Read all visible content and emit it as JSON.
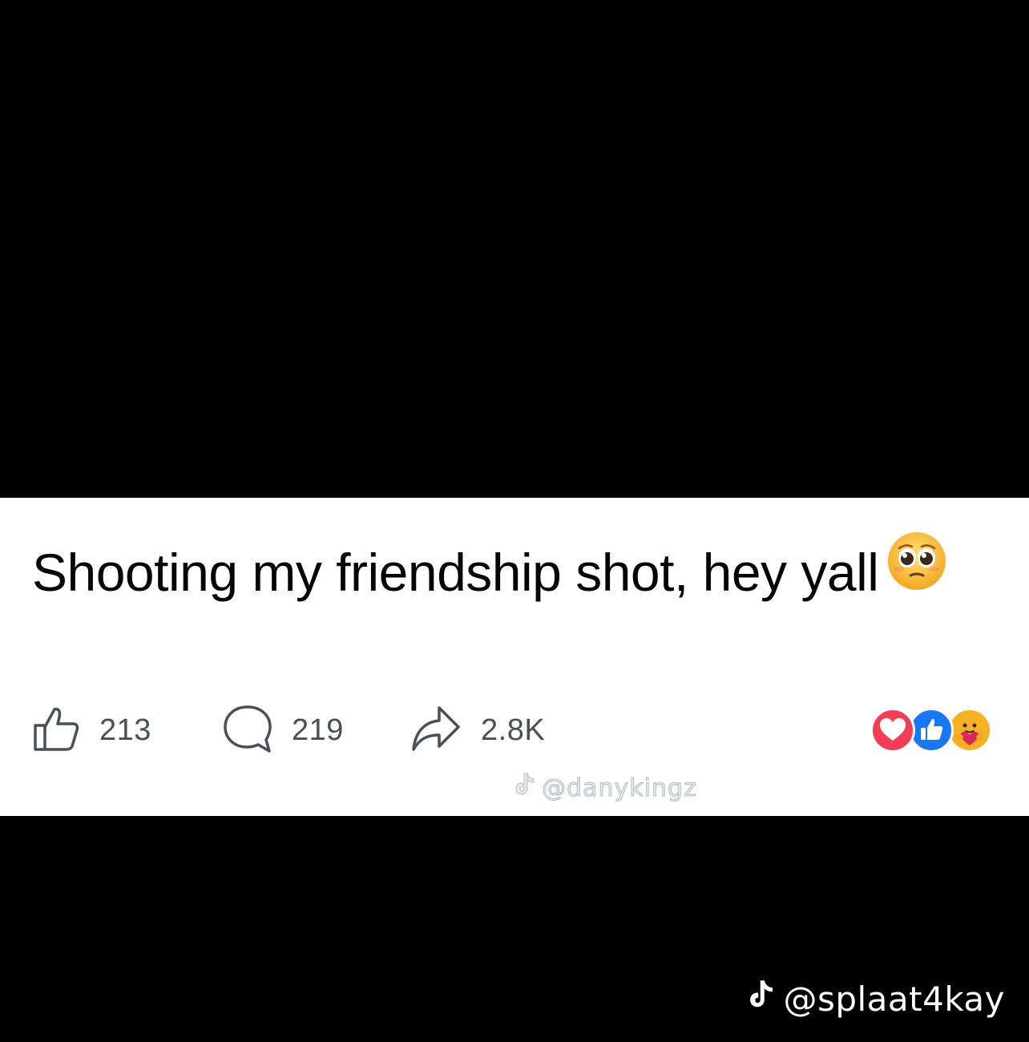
{
  "post": {
    "text": "Shooting my friendship shot, hey yall",
    "emoji": "pleading-face-emoji"
  },
  "stats": {
    "likes": "213",
    "comments": "219",
    "shares": "2.8K"
  },
  "reactions": [
    "love",
    "like",
    "care"
  ],
  "watermarks": {
    "inner_handle": "@danykingz",
    "outer_handle": "@splaat4kay"
  },
  "colors": {
    "love": "#f33e58",
    "like": "#1877f2",
    "care": "#f7b125",
    "text": "#050505",
    "icon": "#4b4f56"
  }
}
